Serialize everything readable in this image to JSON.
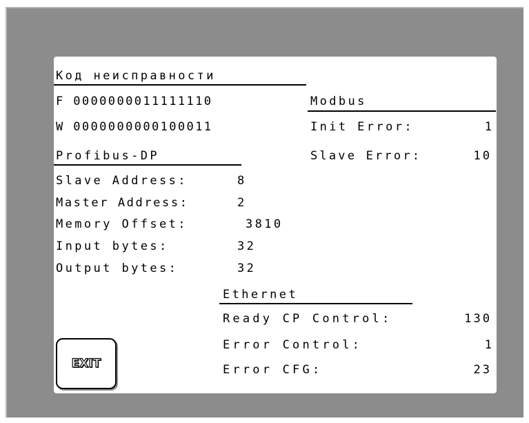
{
  "fault_code": {
    "title": "Код неисправности",
    "f_line": "F 0000000011111110",
    "w_line": "W 0000000000100011"
  },
  "modbus": {
    "title": "Modbus",
    "init_error_label": "Init Error:",
    "init_error_value": "1",
    "slave_error_label": "Slave Error:",
    "slave_error_value": "10"
  },
  "profibus": {
    "title": "Profibus-DP",
    "rows": [
      {
        "label": "Slave Address:",
        "value": "8"
      },
      {
        "label": "Master Address:",
        "value": "2"
      },
      {
        "label": "Memory Offset:",
        "value": "3810"
      },
      {
        "label": "Input bytes:",
        "value": "32"
      },
      {
        "label": "Output bytes:",
        "value": "32"
      }
    ]
  },
  "ethernet": {
    "title": "Ethernet",
    "rows": [
      {
        "label": "Ready CP Control:",
        "value": "130"
      },
      {
        "label": "Error Control:",
        "value": "1"
      },
      {
        "label": "Error CFG:",
        "value": "23"
      }
    ]
  },
  "exit_button": {
    "label": "EXIT"
  }
}
